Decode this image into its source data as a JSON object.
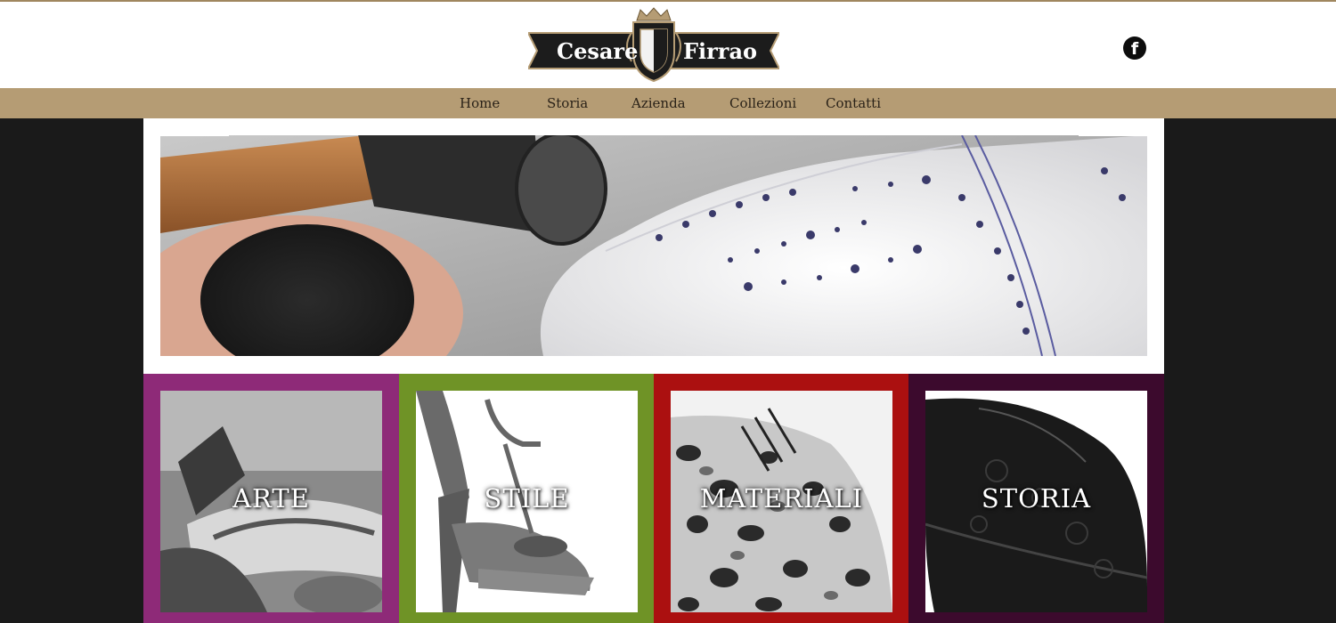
{
  "brand": {
    "name_left": "Cesare",
    "name_right": "Firrao"
  },
  "social": {
    "facebook_glyph": "f",
    "icon": "facebook-icon"
  },
  "nav": {
    "items": [
      {
        "label": "Home"
      },
      {
        "label": "Storia"
      },
      {
        "label": "Azienda"
      },
      {
        "label": "Collezioni"
      },
      {
        "label": "Contatti"
      }
    ]
  },
  "tiles": [
    {
      "label": "ARTE",
      "color": "#8e2a78"
    },
    {
      "label": "STILE",
      "color": "#6f9326"
    },
    {
      "label": "MATERIALI",
      "color": "#ab1010"
    },
    {
      "label": "STORIA",
      "color": "#3c0a2d"
    }
  ],
  "colors": {
    "nav_bar": "#b59c74",
    "background": "#1a1a1a",
    "header": "#ffffff"
  }
}
